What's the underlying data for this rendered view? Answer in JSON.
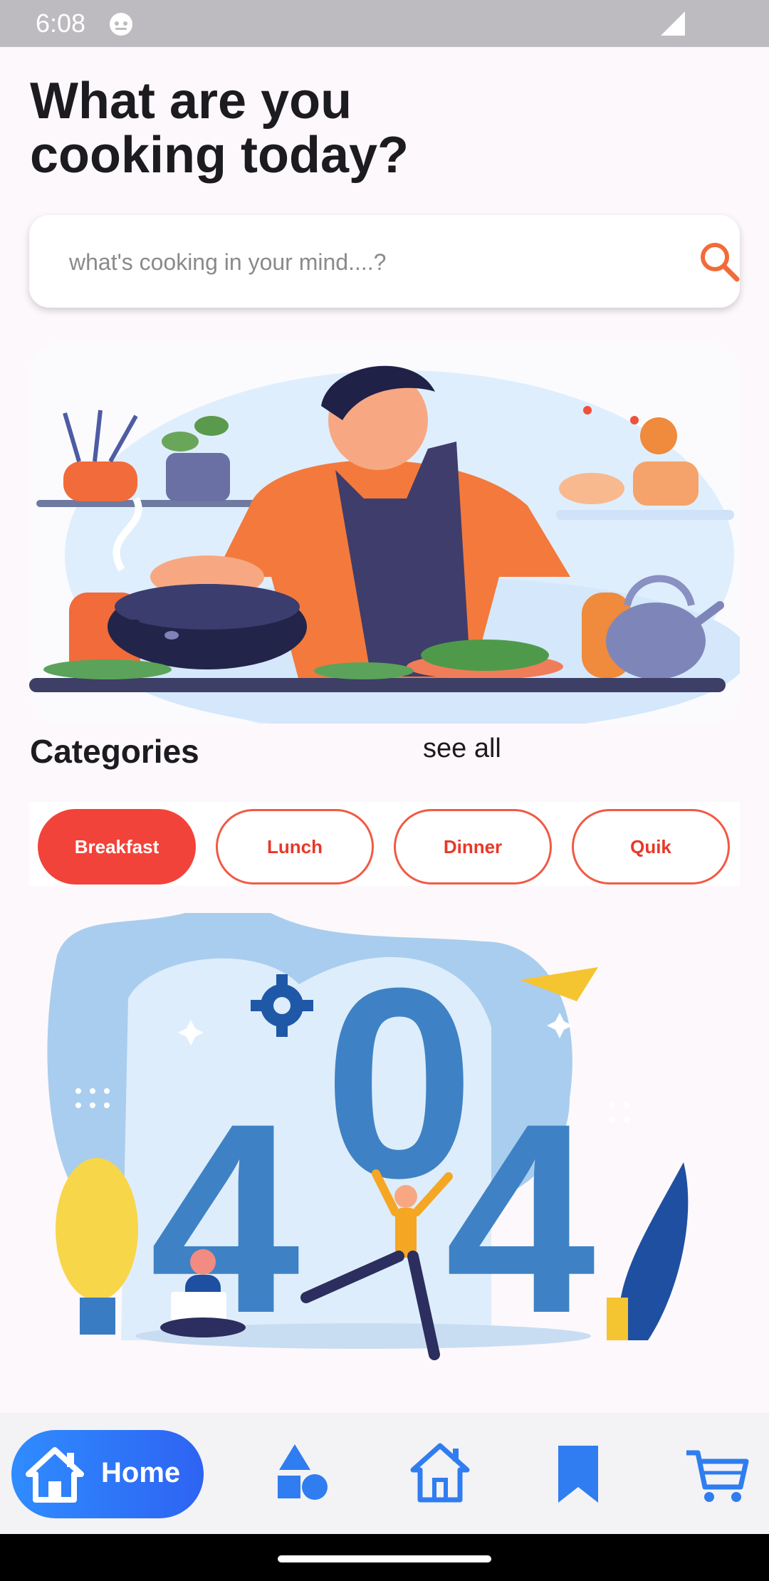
{
  "status_bar": {
    "time": "6:08"
  },
  "header": {
    "title": "What are you\n cooking today?"
  },
  "search": {
    "placeholder": "what's cooking in your mind....?"
  },
  "categories": {
    "title": "Categories",
    "see_all": "see all",
    "chips": [
      {
        "label": "Breakfast",
        "selected": true
      },
      {
        "label": "Lunch",
        "selected": false
      },
      {
        "label": "Dinner",
        "selected": false
      },
      {
        "label": "Quik",
        "selected": false
      }
    ]
  },
  "illustration_404": {
    "digits": [
      "4",
      "0",
      "4"
    ]
  },
  "bottom_nav": {
    "home_label": "Home",
    "items": [
      "home-icon",
      "shapes-icon",
      "home-outline-icon",
      "bookmark-icon",
      "cart-icon"
    ]
  },
  "colors": {
    "accent_red": "#f2433a",
    "search_icon": "#f26b3a",
    "nav_blue": "#2f7df0",
    "error_blue": "#3e82c5"
  }
}
